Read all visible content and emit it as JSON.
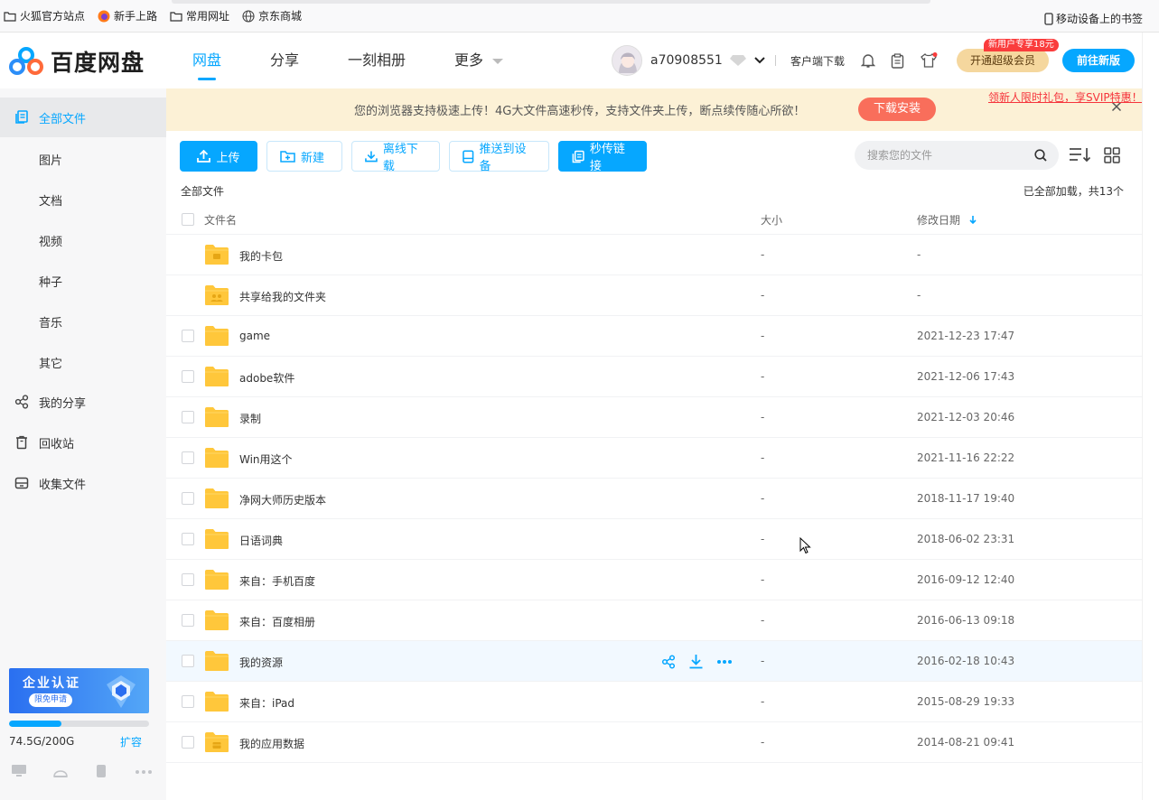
{
  "bookmarks": {
    "items": [
      "火狐官方站点",
      "新手上路",
      "常用网址",
      "京东商城"
    ],
    "mobile": "移动设备上的书签"
  },
  "header": {
    "logo_text": "百度网盘",
    "nav": [
      "网盘",
      "分享",
      "一刻相册",
      "更多"
    ],
    "username": "a70908551",
    "client_download": "客户端下载",
    "svip_button": "开通超级会员",
    "svip_tag": "新用户专享18元",
    "new_version": "前往新版",
    "promo_link": "领新人限时礼包，享SVIP特惠！"
  },
  "sidebar": {
    "all_files": "全部文件",
    "categories": [
      "图片",
      "文档",
      "视频",
      "种子",
      "音乐",
      "其它"
    ],
    "my_share": "我的分享",
    "recycle": "回收站",
    "collect": "收集文件",
    "enterprise_title": "企业认证",
    "enterprise_sub": "限免申请",
    "quota_text": "74.5G/200G",
    "quota_used_fraction": 0.3725,
    "expand": "扩容"
  },
  "banner": {
    "text": "您的浏览器支持极速上传！4G大文件高速秒传，支持文件夹上传，断点续传随心所欲！",
    "button": "下载安装"
  },
  "toolbar": {
    "upload": "上传",
    "new": "新建",
    "offline": "离线下载",
    "push": "推送到设备",
    "instant_link": "秒传链接",
    "search_placeholder": "搜索您的文件"
  },
  "list": {
    "breadcrumb": "全部文件",
    "loaded": "已全部加载，共13个",
    "col_name": "文件名",
    "col_size": "大小",
    "col_date": "修改日期",
    "rows": [
      {
        "name": "我的卡包",
        "size": "-",
        "date": "-",
        "type": "card"
      },
      {
        "name": "共享给我的文件夹",
        "size": "-",
        "date": "-",
        "type": "shared"
      },
      {
        "name": "game",
        "size": "-",
        "date": "2021-12-23 17:47",
        "type": "folder"
      },
      {
        "name": "adobe软件",
        "size": "-",
        "date": "2021-12-06 17:43",
        "type": "folder"
      },
      {
        "name": "录制",
        "size": "-",
        "date": "2021-12-03 20:46",
        "type": "folder"
      },
      {
        "name": "Win用这个",
        "size": "-",
        "date": "2021-11-16 22:22",
        "type": "folder"
      },
      {
        "name": "净网大师历史版本",
        "size": "-",
        "date": "2018-11-17 19:40",
        "type": "folder"
      },
      {
        "name": "日语词典",
        "size": "-",
        "date": "2018-06-02 23:31",
        "type": "folder"
      },
      {
        "name": "来自：手机百度",
        "size": "-",
        "date": "2016-09-12 12:40",
        "type": "folder"
      },
      {
        "name": "来自：百度相册",
        "size": "-",
        "date": "2016-06-13 09:18",
        "type": "folder"
      },
      {
        "name": "我的资源",
        "size": "-",
        "date": "2016-02-18 10:43",
        "type": "folder"
      },
      {
        "name": "来自：iPad",
        "size": "-",
        "date": "2015-08-29 19:33",
        "type": "folder"
      },
      {
        "name": "我的应用数据",
        "size": "-",
        "date": "2014-08-21 09:41",
        "type": "app"
      }
    ]
  },
  "colors": {
    "accent": "#06a7ff",
    "folder": "#ffc73b",
    "banner_bg": "#fcf1d6",
    "banner_button": "#f96e5b",
    "svip": "#f5d79e"
  }
}
